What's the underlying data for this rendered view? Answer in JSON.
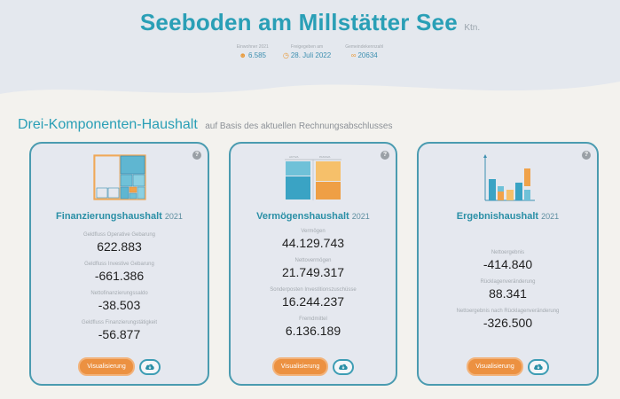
{
  "header": {
    "title": "Seeboden am Millstätter See",
    "title_suffix": "Ktn.",
    "meta": [
      {
        "label": "Einwohner 2021",
        "value": "6.585",
        "icon": "people-icon"
      },
      {
        "label": "Freigegeben am",
        "value": "28. Juli 2022",
        "icon": "clock-icon"
      },
      {
        "label": "Gemeindekennzahl",
        "value": "20634",
        "icon": "id-icon"
      }
    ]
  },
  "section": {
    "title": "Drei-Komponenten-Haushalt",
    "subtitle": "auf Basis des aktuellen Rechnungsabschlusses"
  },
  "cards": [
    {
      "title": "Finanzierungshaushalt",
      "year": "2021",
      "rows": [
        {
          "label": "Geldfluss Operative Gebarung",
          "value": "622.883"
        },
        {
          "label": "Geldfluss Investive Gebarung",
          "value": "-661.386"
        },
        {
          "label": "Nettofinanzierungssaldo",
          "value": "-38.503"
        },
        {
          "label": "Geldfluss Finanzierungstätigkeit",
          "value": "-56.877"
        }
      ],
      "button": "Visualisierung"
    },
    {
      "title": "Vermögenshaushalt",
      "year": "2021",
      "rows": [
        {
          "label": "Vermögen",
          "value": "44.129.743"
        },
        {
          "label": "Nettovermögen",
          "value": "21.749.317"
        },
        {
          "label": "Sonderposten Investitionszuschüsse",
          "value": "16.244.237"
        },
        {
          "label": "Fremdmittel",
          "value": "6.136.189"
        }
      ],
      "button": "Visualisierung"
    },
    {
      "title": "Ergebnishaushalt",
      "year": "2021",
      "rows": [
        {
          "label": "Nettoergebnis",
          "value": "-414.840"
        },
        {
          "label": "Rücklagenveränderung",
          "value": "88.341"
        },
        {
          "label": "Nettoergebnis nach Rücklagenveränderung",
          "value": "-326.500"
        }
      ],
      "button": "Visualisierung"
    }
  ],
  "colors": {
    "accent": "#2a9fb6",
    "orange": "#ec9141",
    "card_border": "#4a9bb0"
  }
}
